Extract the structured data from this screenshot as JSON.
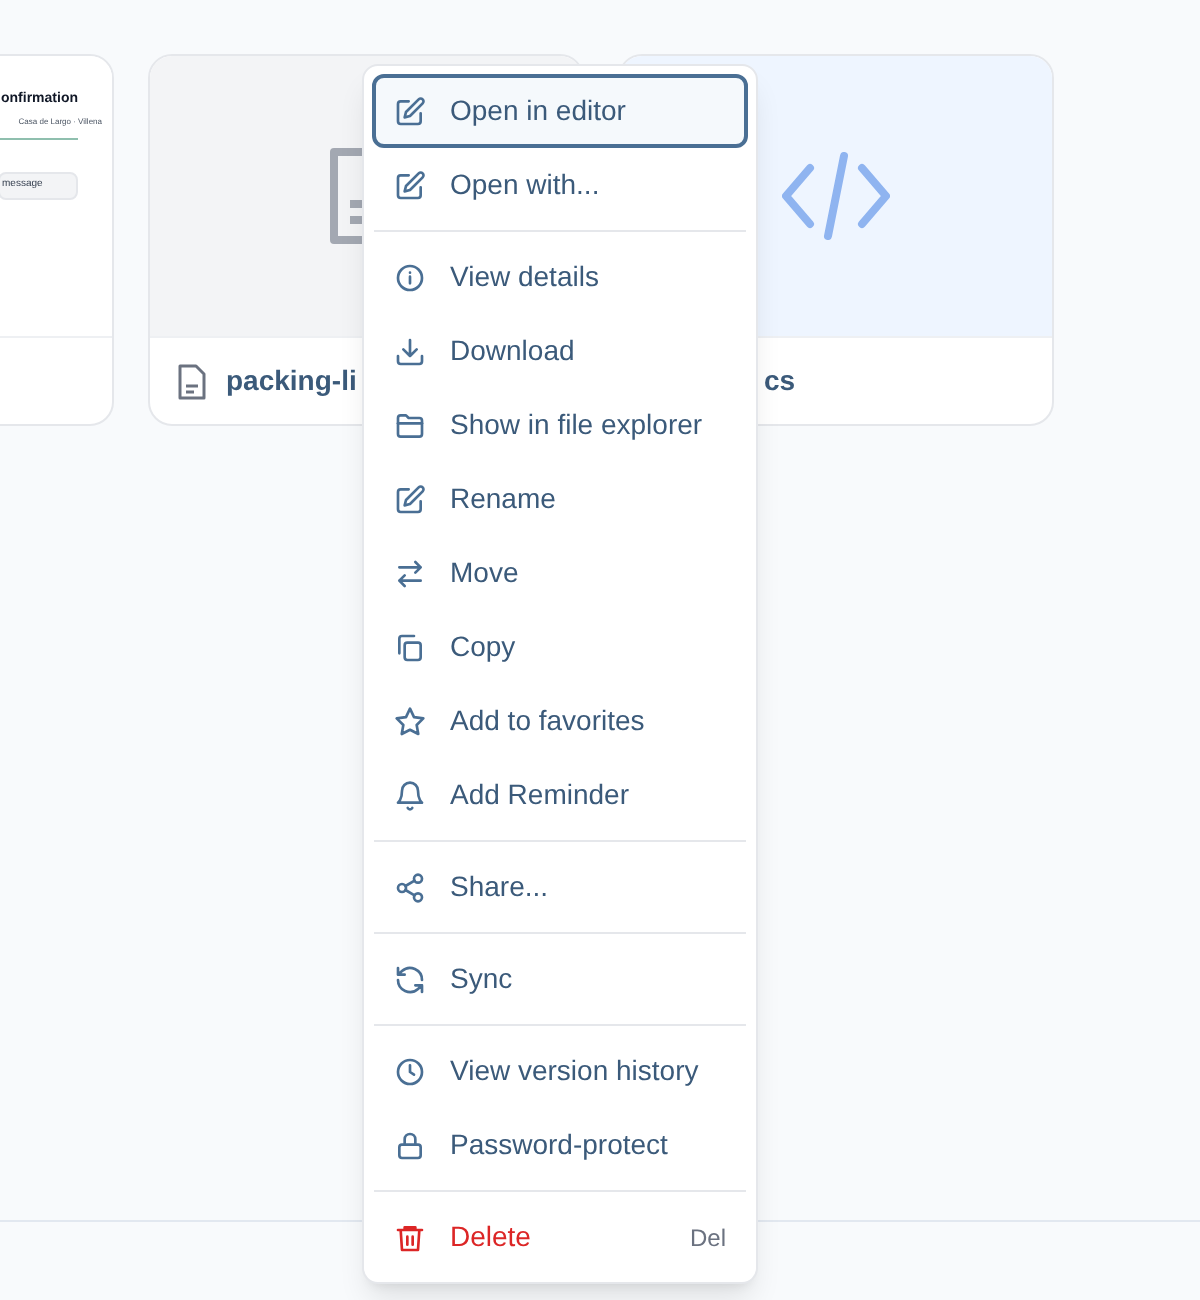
{
  "cards": [
    {
      "kind": "document",
      "preview_title": "onfirmation",
      "preview_subtitle": "Casa de Largo · Villena",
      "preview_field": "message"
    },
    {
      "kind": "file",
      "name": "packing-li"
    },
    {
      "kind": "code",
      "name": "cs"
    }
  ],
  "context_menu": [
    {
      "kind": "item",
      "label": "Open in editor",
      "focused": true
    },
    {
      "kind": "item",
      "label": "Open with...",
      "focused": false
    },
    {
      "kind": "divider"
    },
    {
      "kind": "item",
      "label": "View details",
      "focused": false
    },
    {
      "kind": "item",
      "label": "Download",
      "focused": false
    },
    {
      "kind": "item",
      "label": "Show in file explorer",
      "focused": false
    },
    {
      "kind": "item",
      "label": "Rename",
      "focused": false
    },
    {
      "kind": "item",
      "label": "Move",
      "focused": false
    },
    {
      "kind": "item",
      "label": "Copy",
      "focused": false
    },
    {
      "kind": "item",
      "label": "Add to favorites",
      "focused": false
    },
    {
      "kind": "item",
      "label": "Add Reminder",
      "focused": false
    },
    {
      "kind": "divider"
    },
    {
      "kind": "item",
      "label": "Share...",
      "focused": false
    },
    {
      "kind": "divider"
    },
    {
      "kind": "item",
      "label": "Sync",
      "focused": false
    },
    {
      "kind": "divider"
    },
    {
      "kind": "item",
      "label": "View version history",
      "focused": false
    },
    {
      "kind": "item",
      "label": "Password-protect",
      "focused": false
    },
    {
      "kind": "divider"
    },
    {
      "kind": "item",
      "label": "Delete",
      "focused": false,
      "danger": true,
      "shortcut": "Del"
    }
  ]
}
